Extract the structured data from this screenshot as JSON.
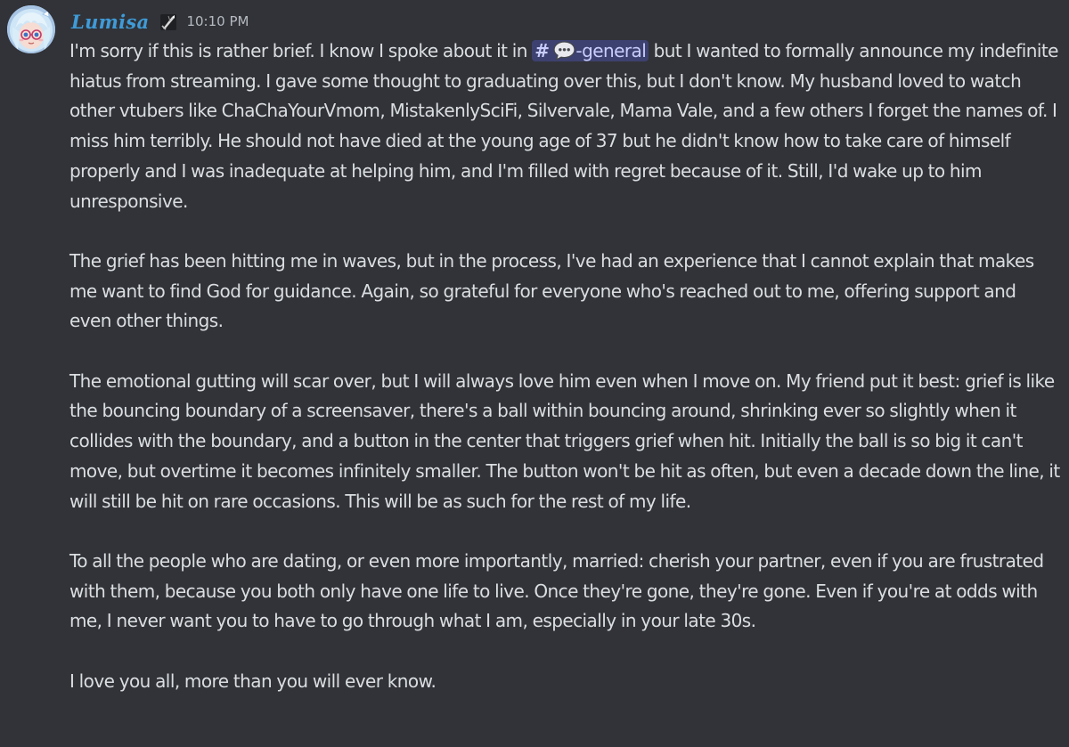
{
  "message": {
    "author": "Lumisa",
    "timestamp": "10:10 PM",
    "icons": {
      "avatar": "avatar-anime-girl-blue-hair",
      "role": "sword-badge-icon",
      "channel_emoji": "speech-bubble-icon"
    },
    "mention": {
      "prefix": "#",
      "channel": "-general"
    },
    "paragraphs": [
      {
        "before_mention": "I'm sorry if this is rather brief. I know I spoke about it in ",
        "after_mention": " but I wanted to formally announce my indefinite hiatus from streaming. I gave some thought to graduating over this, but I don't know. My husband loved to watch other vtubers like ChaChaYourVmom, MistakenlySciFi, Silvervale, Mama Vale, and a few others I forget the names of. I miss him terribly. He should not have died at the young age of 37 but he didn't know how to take care of himself properly and I was inadequate at helping him, and I'm filled with regret because of it. Still, I'd wake up to him unresponsive."
      },
      {
        "text": "The grief has been hitting me in waves, but in the process, I've had an experience that I cannot explain that makes me want to find God for guidance. Again, so grateful for everyone who's reached out to me, offering support and even other things."
      },
      {
        "text": "The emotional gutting will scar over, but I will always love him even when I move on. My friend put it best: grief is like the bouncing boundary of a screensaver, there's a ball within bouncing around, shrinking ever so slightly when it collides with the boundary, and a button in the center that triggers grief when hit. Initially the ball is so big it can't move, but overtime it becomes infinitely smaller. The button won't be hit as often, but even a decade down the line, it will still be hit on rare occasions. This will be as such for the rest of my life."
      },
      {
        "text": "To all the people who are dating, or even more importantly, married: cherish your partner, even if you are frustrated with them, because you both only have one life to live. Once they're gone, they're gone. Even if you're at odds with me, I never want you to have to go through what I am, especially in your late 30s."
      },
      {
        "text": "I love you all, more than you will ever know."
      }
    ]
  },
  "colors": {
    "background": "#313338",
    "text": "#dbdee1",
    "username": "#3f9bd8",
    "timestamp": "#b5bac1",
    "mention_text": "#c9cdfb",
    "mention_bg": "rgba(88,101,242,0.3)"
  }
}
